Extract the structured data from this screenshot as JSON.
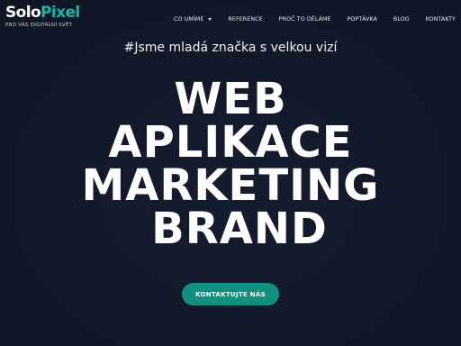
{
  "brand": {
    "logo_part1": "Solo",
    "logo_part2": "Pixel",
    "tagline": "PRO VÁS DIGITÁLNÍ SVĚT",
    "accent_color": "#19b5a5",
    "background_color": "#121a2b"
  },
  "nav": {
    "items": [
      {
        "label": "CO UMÍME",
        "has_dropdown": true
      },
      {
        "label": "REFERENCE"
      },
      {
        "label": "PROČ TO DĚLÁME"
      },
      {
        "label": "POPTÁVKA"
      },
      {
        "label": "BLOG"
      },
      {
        "label": "KONTAKTY"
      }
    ],
    "dropdown_icon": "chevron-down-icon"
  },
  "hero": {
    "subtitle": "#Jsme mladá značka s velkou vizí",
    "lines": [
      "WEB",
      "APLIKACE",
      "MARKETING",
      "BRAND"
    ],
    "cta_label": "KONTAKTUJTE NÁS",
    "cta_color": "#12907f"
  }
}
